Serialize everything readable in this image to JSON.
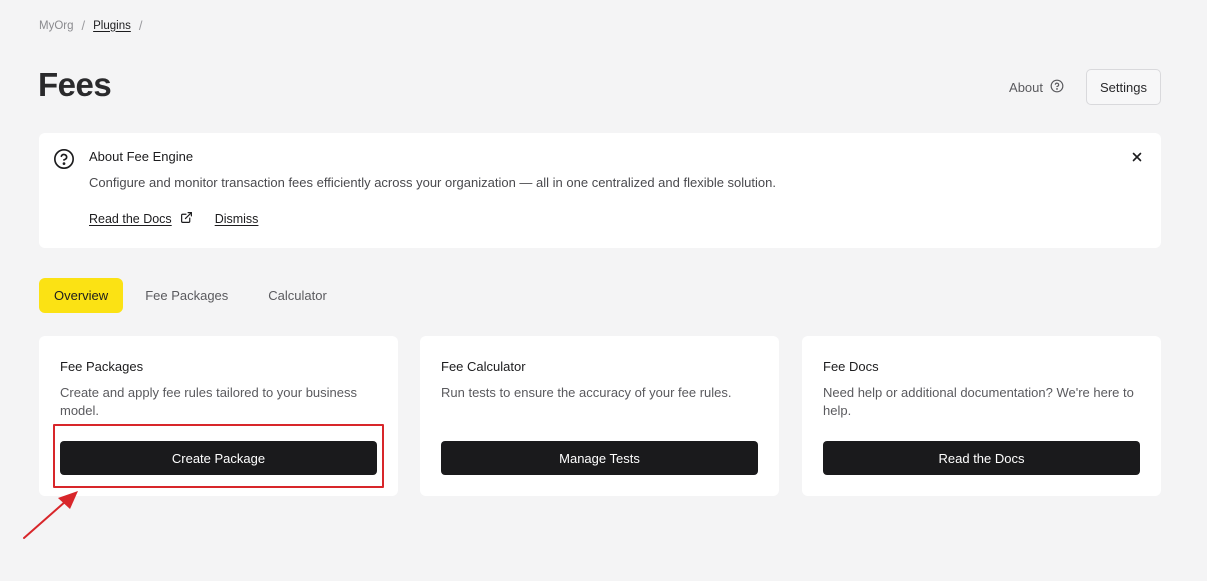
{
  "breadcrumb": {
    "items": [
      "MyOrg",
      "Plugins"
    ],
    "separator": "/"
  },
  "header": {
    "title": "Fees",
    "about_label": "About",
    "settings_label": "Settings"
  },
  "banner": {
    "title": "About Fee Engine",
    "description": "Configure and monitor transaction fees efficiently across your organization — all in one centralized and flexible solution.",
    "docs_link": "Read the Docs",
    "dismiss_link": "Dismiss"
  },
  "tabs": [
    {
      "label": "Overview",
      "active": true
    },
    {
      "label": "Fee Packages",
      "active": false
    },
    {
      "label": "Calculator",
      "active": false
    }
  ],
  "cards": [
    {
      "title": "Fee Packages",
      "description": "Create and apply fee rules tailored to your business model.",
      "button": "Create Package"
    },
    {
      "title": "Fee Calculator",
      "description": "Run tests to ensure the accuracy of your fee rules.",
      "button": "Manage Tests"
    },
    {
      "title": "Fee Docs",
      "description": "Need help or additional documentation? We're here to help.",
      "button": "Read the Docs"
    }
  ],
  "colors": {
    "accent_tab": "#fbe214",
    "button_bg": "#1a1a1c",
    "annotation": "#d8262a",
    "page_bg": "#f4f4f5"
  },
  "icons": {
    "about": "help-circle-icon",
    "banner": "help-circle-icon",
    "docs_link": "external-link-icon",
    "close": "close-icon"
  }
}
